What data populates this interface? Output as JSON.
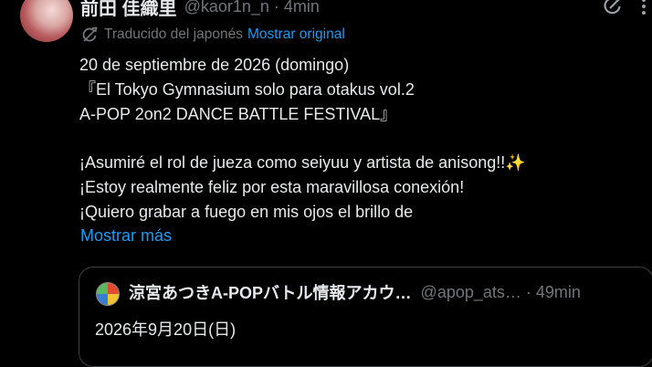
{
  "author": {
    "display_name": "前田 佳織里",
    "handle": "@kaor1n_n",
    "separator": "·",
    "time": "4min"
  },
  "translation": {
    "label": "Traducido del japonés",
    "show_original": "Mostrar original"
  },
  "tweet": {
    "lines": [
      "20 de septiembre de 2026 (domingo)",
      "『El Tokyo Gymnasium solo para otakus vol.2",
      "A-POP 2on2 DANCE BATTLE FESTIVAL』",
      "",
      "¡Asumiré el rol de jueza como seiyuu y artista de anisong!!✨",
      "¡Estoy realmente feliz por esta maravillosa conexión!",
      "¡Quiero grabar a fuego en mis ojos el brillo de"
    ],
    "show_more": "Mostrar más"
  },
  "quote": {
    "display_name": "涼宮あつきA-POPバトル情報アカウ…",
    "handle": "@apop_ats…",
    "separator": "·",
    "time": "49min",
    "text": "2026年9月20日(日)"
  },
  "icons": {
    "avatar": "profile-photo",
    "translate": "refresh-translate-icon",
    "grok": "grok-icon",
    "more": "more-options-icon"
  },
  "colors": {
    "background": "#000000",
    "text": "#e7e9ea",
    "muted": "#71767b",
    "link": "#1d9bf0",
    "border": "#3e4144"
  }
}
